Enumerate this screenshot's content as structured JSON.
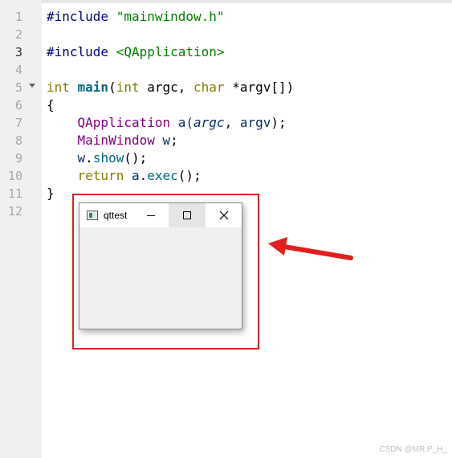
{
  "editor": {
    "line_numbers": [
      "1",
      "2",
      "3",
      "4",
      "5",
      "6",
      "7",
      "8",
      "9",
      "10",
      "11",
      "12"
    ],
    "current_line": "3",
    "lines": [
      [
        {
          "t": "#include ",
          "c": "kw-pp"
        },
        {
          "t": "\"mainwindow.h\"",
          "c": "kw-str"
        }
      ],
      [],
      [
        {
          "t": "#include ",
          "c": "kw-pp"
        },
        {
          "t": "<QApplication>",
          "c": "kw-str"
        }
      ],
      [],
      [
        {
          "t": "int ",
          "c": "kw-type"
        },
        {
          "t": "main",
          "c": "kw-fn"
        },
        {
          "t": "(",
          "c": ""
        },
        {
          "t": "int ",
          "c": "kw-type"
        },
        {
          "t": "argc, ",
          "c": ""
        },
        {
          "t": "char ",
          "c": "kw-type"
        },
        {
          "t": "*argv[])",
          "c": ""
        }
      ],
      [
        {
          "t": "{",
          "c": ""
        }
      ],
      [
        {
          "t": "    ",
          "c": ""
        },
        {
          "t": "QApplication ",
          "c": "kw-cls"
        },
        {
          "t": "a(",
          "c": "kw-var"
        },
        {
          "t": "argc",
          "c": "kw-param"
        },
        {
          "t": ", ",
          "c": ""
        },
        {
          "t": "argv",
          "c": "kw-var"
        },
        {
          "t": ");",
          "c": ""
        }
      ],
      [
        {
          "t": "    ",
          "c": ""
        },
        {
          "t": "MainWindow ",
          "c": "kw-cls"
        },
        {
          "t": "w",
          "c": "kw-var"
        },
        {
          "t": ";",
          "c": ""
        }
      ],
      [
        {
          "t": "    ",
          "c": ""
        },
        {
          "t": "w",
          "c": "kw-var"
        },
        {
          "t": ".",
          "c": ""
        },
        {
          "t": "show",
          "c": "kw-method"
        },
        {
          "t": "();",
          "c": ""
        }
      ],
      [
        {
          "t": "    ",
          "c": ""
        },
        {
          "t": "return ",
          "c": "kw-type"
        },
        {
          "t": "a",
          "c": "kw-var"
        },
        {
          "t": ".",
          "c": ""
        },
        {
          "t": "exec",
          "c": "kw-method"
        },
        {
          "t": "();",
          "c": ""
        }
      ],
      [
        {
          "t": "}",
          "c": ""
        }
      ],
      []
    ],
    "colors": {
      "preprocessor": "#000080",
      "string": "#008000",
      "keyword": "#808000",
      "class": "#800080",
      "function": "#00677c"
    }
  },
  "qt_window": {
    "title": "qttest",
    "icons": [
      "app-icon",
      "minimize-icon",
      "maximize-icon",
      "close-icon"
    ]
  },
  "annotation": {
    "frame_color": "#e02020",
    "arrow_color": "#e02020"
  },
  "watermark": "CSDN @MR.P_H_"
}
